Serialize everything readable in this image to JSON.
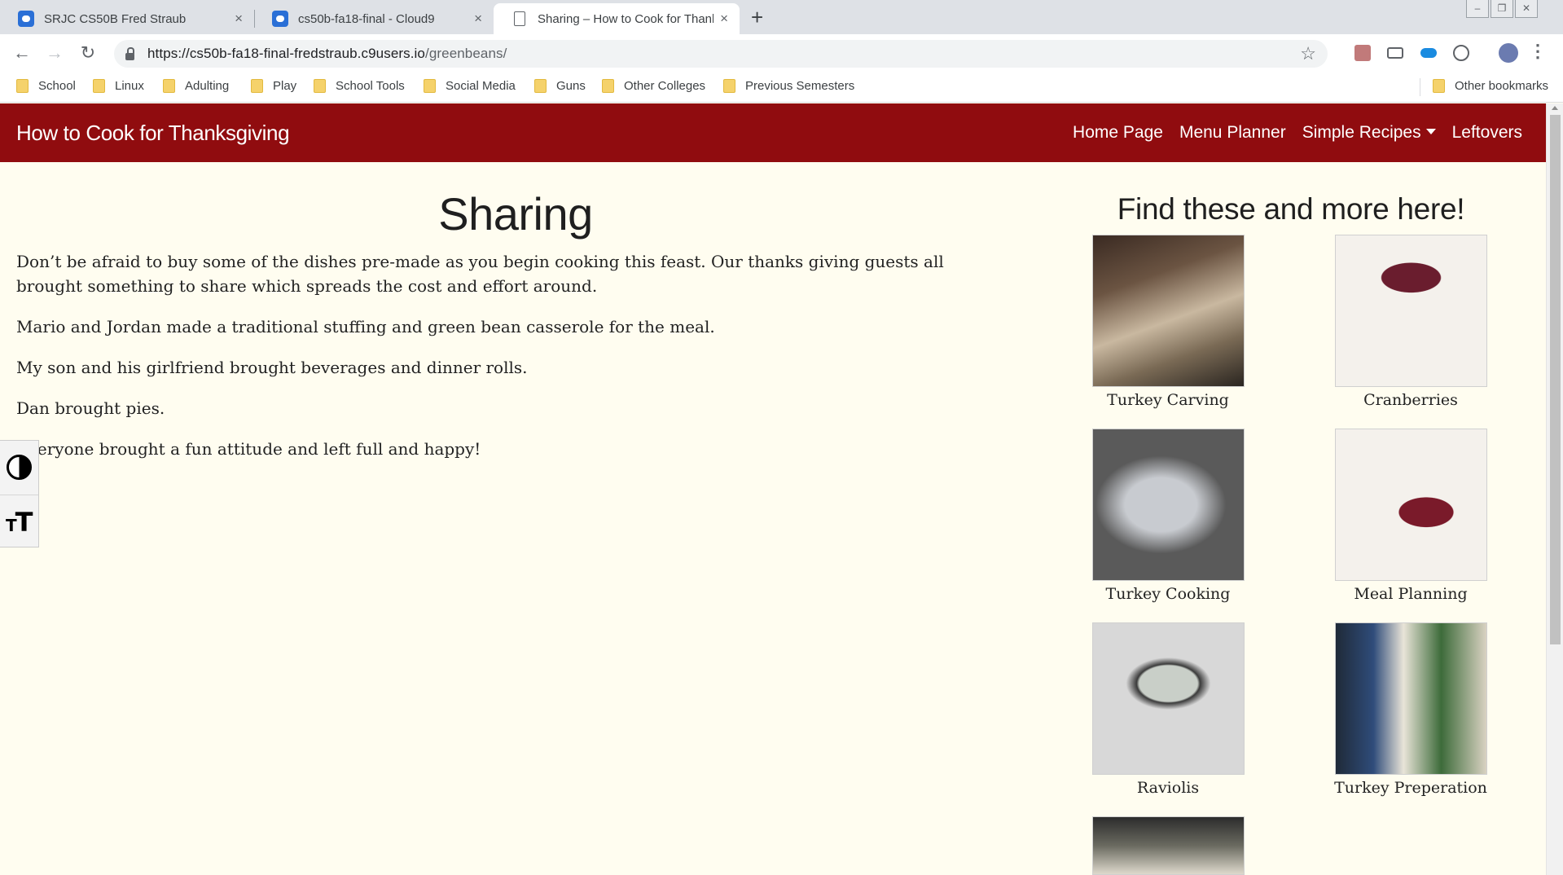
{
  "browser": {
    "tabs": [
      {
        "title": "SRJC CS50B Fred Straub",
        "close": "×"
      },
      {
        "title": "cs50b-fa18-final - Cloud9",
        "close": "×"
      },
      {
        "title": "Sharing – How to Cook for Thank",
        "close": "×"
      }
    ],
    "new_tab": "+",
    "url_host": "https://cs50b-fa18-final-fredstraub.c9users.io",
    "url_path": "/greenbeans/",
    "bookmarks": [
      "School",
      "Linux",
      "Adulting",
      "Play",
      "School Tools",
      "Social Media",
      "Guns",
      "Other Colleges",
      "Previous Semesters"
    ],
    "other_bookmarks": "Other bookmarks",
    "icons": {
      "back": "arrow-left-icon",
      "forward": "arrow-right-icon",
      "reload": "reload-icon",
      "bookmark": "star-icon",
      "menu": "kebab-icon"
    }
  },
  "site": {
    "brand": "How to Cook for Thanksgiving",
    "nav": [
      "Home Page",
      "Menu Planner",
      "Simple Recipes",
      "Leftovers"
    ],
    "colors": {
      "navbar": "#900c0f",
      "background": "#fffdf0"
    }
  },
  "main": {
    "title": "Sharing",
    "paragraphs": [
      "Don’t be afraid to buy some of the dishes pre-made as you begin cooking this feast.  Our thanks giving guests all brought something to share which spreads the cost and effort around.",
      "Mario and Jordan made a traditional stuffing and green bean casserole for the meal.",
      "My son and his girlfriend brought beverages and dinner rolls.",
      "Dan brought pies.",
      "Everyone brought a fun attitude and left full and happy!"
    ]
  },
  "sidebar": {
    "title": "Find these and more here!",
    "items": [
      {
        "caption": "Turkey Carving"
      },
      {
        "caption": "Cranberries"
      },
      {
        "caption": "Turkey Cooking"
      },
      {
        "caption": "Meal Planning"
      },
      {
        "caption": "Raviolis"
      },
      {
        "caption": "Turkey Preperation"
      },
      {
        "caption": ""
      }
    ]
  },
  "accessibility": {
    "contrast_icon": "contrast-icon",
    "font_size_icon": "font-size-icon"
  }
}
